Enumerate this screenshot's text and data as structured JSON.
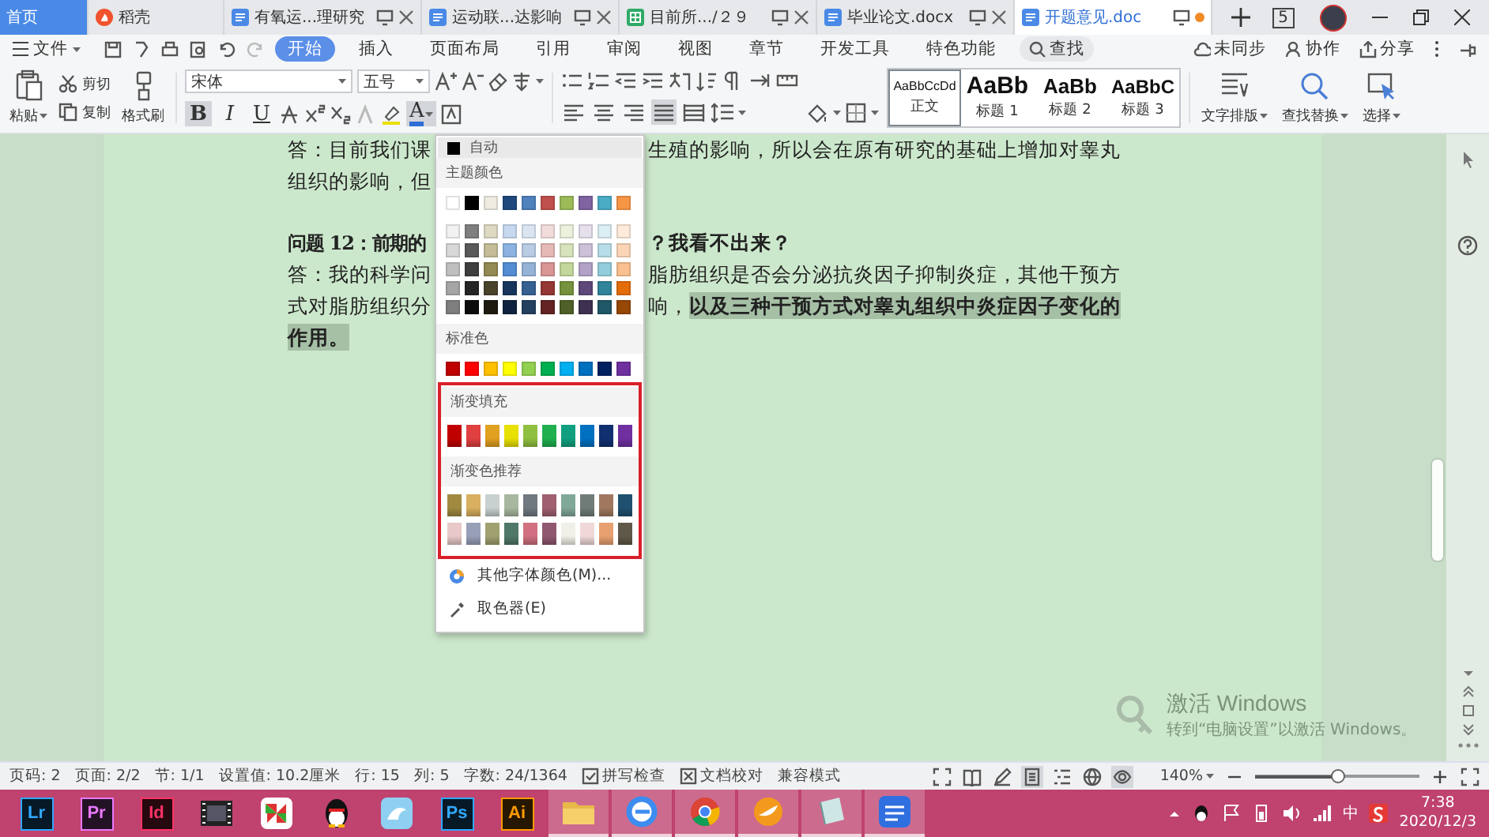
{
  "tab_bar": {
    "tabs": [
      {
        "label": "首页",
        "kind": "home",
        "selected": false,
        "modified": false
      },
      {
        "label": "稻壳",
        "kind": "docer",
        "selected": false,
        "modified": false
      },
      {
        "label": "有氧运...理研究",
        "kind": "writer",
        "selected": false,
        "modified": false
      },
      {
        "label": "运动联...达影响",
        "kind": "writer",
        "selected": false,
        "modified": false
      },
      {
        "label": "目前所.../２９",
        "kind": "sheet",
        "selected": false,
        "modified": false
      },
      {
        "label": "毕业论文.docx",
        "kind": "writer",
        "selected": false,
        "modified": false
      },
      {
        "label": "开题意见.doc",
        "kind": "writer",
        "selected": true,
        "modified": true
      }
    ],
    "window_count": "5"
  },
  "menu_bar": {
    "file_label": "文件",
    "tabs": [
      {
        "label": "开始",
        "selected": true
      },
      {
        "label": "插入",
        "selected": false
      },
      {
        "label": "页面布局",
        "selected": false
      },
      {
        "label": "引用",
        "selected": false
      },
      {
        "label": "审阅",
        "selected": false
      },
      {
        "label": "视图",
        "selected": false
      },
      {
        "label": "章节",
        "selected": false
      },
      {
        "label": "开发工具",
        "selected": false
      },
      {
        "label": "特色功能",
        "selected": false
      }
    ],
    "search_label": "查找",
    "actions": [
      {
        "label": "未同步",
        "kind": "sync"
      },
      {
        "label": "协作",
        "kind": "collab"
      },
      {
        "label": "分享",
        "kind": "share"
      }
    ]
  },
  "ribbon": {
    "paste_label": "粘贴",
    "cut_label": "剪切",
    "copy_label": "复制",
    "format_painter_label": "格式刷",
    "font_name": "宋体",
    "font_size": "五号",
    "format_buttons": [
      {
        "label": "B",
        "kind": "bold",
        "pressed": true
      },
      {
        "label": "I",
        "kind": "italic",
        "pressed": false
      },
      {
        "label": "U",
        "kind": "underline",
        "pressed": false
      }
    ],
    "font_color": {
      "label": "A",
      "open": true
    },
    "paragraph_align": [
      {
        "kind": "left",
        "selected": false
      },
      {
        "kind": "center",
        "selected": false
      },
      {
        "kind": "right",
        "selected": false
      },
      {
        "kind": "justify",
        "selected": true
      },
      {
        "kind": "distributed",
        "selected": false
      }
    ],
    "styles": [
      {
        "sample": "AaBbCcDd",
        "label": "正文",
        "selected": true
      },
      {
        "sample": "AaBb",
        "label": "标题 1",
        "selected": false
      },
      {
        "sample": "AaBb",
        "label": "标题 2",
        "selected": false
      },
      {
        "sample": "AaBbC",
        "label": "标题 3",
        "selected": false
      }
    ],
    "tools": [
      {
        "label": "文字排版",
        "kind": "layout"
      },
      {
        "label": "查找替换",
        "kind": "find"
      },
      {
        "label": "选择",
        "kind": "select"
      }
    ]
  },
  "document": {
    "paragraphs": [
      {
        "kind": "answer",
        "lines": [
          {
            "left": "答：目前我们课",
            "right": "生殖的影响，所以会在原有研究的基础上增加对睾丸"
          },
          {
            "left": "组织的影响，但"
          }
        ]
      },
      {
        "kind": "question",
        "lines": [
          {
            "left": "问题 12：前期的",
            "right": "？我看不出来？"
          }
        ]
      },
      {
        "kind": "answer",
        "lines": [
          {
            "left": "答：我的科学问",
            "right": "脂肪组织是否会分泌抗炎因子抑制炎症，其他干预方"
          },
          {
            "left": "式对脂肪组织分",
            "right": "响，**以及三种干预方式对睾丸组织中炎症因子变化的**"
          },
          {
            "left": "**作用。**"
          }
        ]
      }
    ]
  },
  "color_menu": {
    "auto_label": "自动",
    "theme_title": "主题颜色",
    "theme_rows": [
      [
        {
          "color": "#ffffff"
        },
        {
          "color": "#000000"
        },
        {
          "color": "#eeece1"
        },
        {
          "color": "#1f497d"
        },
        {
          "color": "#4f81bd"
        },
        {
          "color": "#c0504d"
        },
        {
          "color": "#9bbb59"
        },
        {
          "color": "#8064a2"
        },
        {
          "color": "#4bacc6"
        },
        {
          "color": "#f79646"
        }
      ],
      [
        {
          "color": "#f2f2f2"
        },
        {
          "color": "#7f7f7f"
        },
        {
          "color": "#ddd9c3"
        },
        {
          "color": "#c6d9f0"
        },
        {
          "color": "#dbe5f1"
        },
        {
          "color": "#f2dcdb"
        },
        {
          "color": "#ebf1dd"
        },
        {
          "color": "#e5e0ec"
        },
        {
          "color": "#dbeef3"
        },
        {
          "color": "#fdeada"
        }
      ],
      [
        {
          "color": "#d8d8d8"
        },
        {
          "color": "#595959"
        },
        {
          "color": "#c4bd97"
        },
        {
          "color": "#8db3e2"
        },
        {
          "color": "#b8cce4"
        },
        {
          "color": "#e5b9b7"
        },
        {
          "color": "#d7e3bc"
        },
        {
          "color": "#ccc1d9"
        },
        {
          "color": "#b7dde8"
        },
        {
          "color": "#fbd5b5"
        }
      ],
      [
        {
          "color": "#bfbfbf"
        },
        {
          "color": "#3f3f3f"
        },
        {
          "color": "#938953"
        },
        {
          "color": "#548dd4"
        },
        {
          "color": "#95b3d7"
        },
        {
          "color": "#d99694"
        },
        {
          "color": "#c3d69b"
        },
        {
          "color": "#b2a2c7"
        },
        {
          "color": "#92cddc"
        },
        {
          "color": "#fac08f"
        }
      ],
      [
        {
          "color": "#a5a5a5"
        },
        {
          "color": "#262626"
        },
        {
          "color": "#494429"
        },
        {
          "color": "#17365d"
        },
        {
          "color": "#366092"
        },
        {
          "color": "#953734"
        },
        {
          "color": "#76923c"
        },
        {
          "color": "#5f497a"
        },
        {
          "color": "#31859b"
        },
        {
          "color": "#e36c09"
        }
      ],
      [
        {
          "color": "#7f7f7f"
        },
        {
          "color": "#0c0c0c"
        },
        {
          "color": "#1d1b10"
        },
        {
          "color": "#0f243e"
        },
        {
          "color": "#244061"
        },
        {
          "color": "#632423"
        },
        {
          "color": "#4f6128"
        },
        {
          "color": "#3f3151"
        },
        {
          "color": "#205867"
        },
        {
          "color": "#974806"
        }
      ]
    ],
    "standard_title": "标准色",
    "standard_colors": [
      {
        "color": "#c00000"
      },
      {
        "color": "#ff0000"
      },
      {
        "color": "#ffc000"
      },
      {
        "color": "#ffff00"
      },
      {
        "color": "#92d050"
      },
      {
        "color": "#00b050"
      },
      {
        "color": "#00b0f0"
      },
      {
        "color": "#0070c0"
      },
      {
        "color": "#002060"
      },
      {
        "color": "#7030a0"
      }
    ],
    "gradient_group": {
      "annotated": true,
      "fill_title": "渐变填充",
      "fill_colors": [
        {
          "color": "#c00000"
        },
        {
          "color": "#e04040"
        },
        {
          "color": "#e0a020"
        },
        {
          "color": "#e8e000"
        },
        {
          "color": "#90c040"
        },
        {
          "color": "#20b050"
        },
        {
          "color": "#10a080"
        },
        {
          "color": "#0070c0"
        },
        {
          "color": "#103070"
        },
        {
          "color": "#7030a0"
        }
      ],
      "recommended_title": "渐变色推荐",
      "recommended_rows": [
        [
          {
            "color": "#a08a40"
          },
          {
            "color": "#d8b060"
          },
          {
            "color": "#c8d0d0"
          },
          {
            "color": "#a8b8a0"
          },
          {
            "color": "#707880"
          },
          {
            "color": "#a06070"
          },
          {
            "color": "#80a898"
          },
          {
            "color": "#707c78"
          },
          {
            "color": "#a07860"
          },
          {
            "color": "#205070"
          }
        ],
        [
          {
            "color": "#e8c8c8"
          },
          {
            "color": "#98a0b8"
          },
          {
            "color": "#a0a070"
          },
          {
            "color": "#507868"
          },
          {
            "color": "#d07080"
          },
          {
            "color": "#905870"
          },
          {
            "color": "#f0f0e8"
          },
          {
            "color": "#f0d8d8"
          },
          {
            "color": "#e8a070"
          },
          {
            "color": "#605848"
          }
        ]
      ]
    },
    "more_label": "其他字体颜色(M)...",
    "picker_label": "取色器(E)"
  },
  "os_notice": {
    "title": "激活 Windows",
    "body": "转到“电脑设置”以激活 Windows。"
  },
  "status_bar": {
    "fields": [
      "页码: 2",
      "页面: 2/2",
      "节: 1/1",
      "设置值: 10.2厘米",
      "行: 15",
      "列: 5",
      "字数: 24/1364"
    ],
    "checks": [
      {
        "label": "拼写检查",
        "kind": "spell"
      },
      {
        "label": "文档校对",
        "kind": "proof"
      }
    ],
    "mode": "兼容模式",
    "views": [
      {
        "kind": "fullscreen",
        "selected": false
      },
      {
        "kind": "read",
        "selected": false
      },
      {
        "kind": "write",
        "selected": false
      },
      {
        "kind": "page",
        "selected": true
      },
      {
        "kind": "outline",
        "selected": false
      },
      {
        "kind": "web",
        "selected": false
      },
      {
        "kind": "eye",
        "selected": true
      }
    ],
    "zoom": "140%",
    "zoom_slider": {
      "level": 0.5
    }
  },
  "taskbar": {
    "apps": [
      {
        "kind": "tile",
        "label": "Lr",
        "color": "#31a8ff",
        "running": false
      },
      {
        "kind": "tile",
        "label": "Pr",
        "color": "#ea77ff",
        "running": false
      },
      {
        "kind": "tile",
        "label": "Id",
        "color": "#ff3366",
        "running": false
      },
      {
        "kind": "film",
        "running": false
      },
      {
        "kind": "pinwheel",
        "running": false
      },
      {
        "kind": "penguin",
        "running": false
      },
      {
        "kind": "bird",
        "running": false
      },
      {
        "kind": "tile",
        "label": "Ps",
        "color": "#31a8ff",
        "running": false
      },
      {
        "kind": "tile",
        "label": "Ai",
        "color": "#ff9a00",
        "running": false
      },
      {
        "kind": "folder",
        "running": true
      },
      {
        "kind": "browser",
        "running": true
      },
      {
        "kind": "chrome",
        "running": true
      },
      {
        "kind": "fox",
        "running": true
      },
      {
        "kind": "notebook",
        "running": true
      },
      {
        "kind": "wps",
        "running": true
      }
    ],
    "ime": "中",
    "time": "7:38",
    "date": "2020/12/3"
  }
}
